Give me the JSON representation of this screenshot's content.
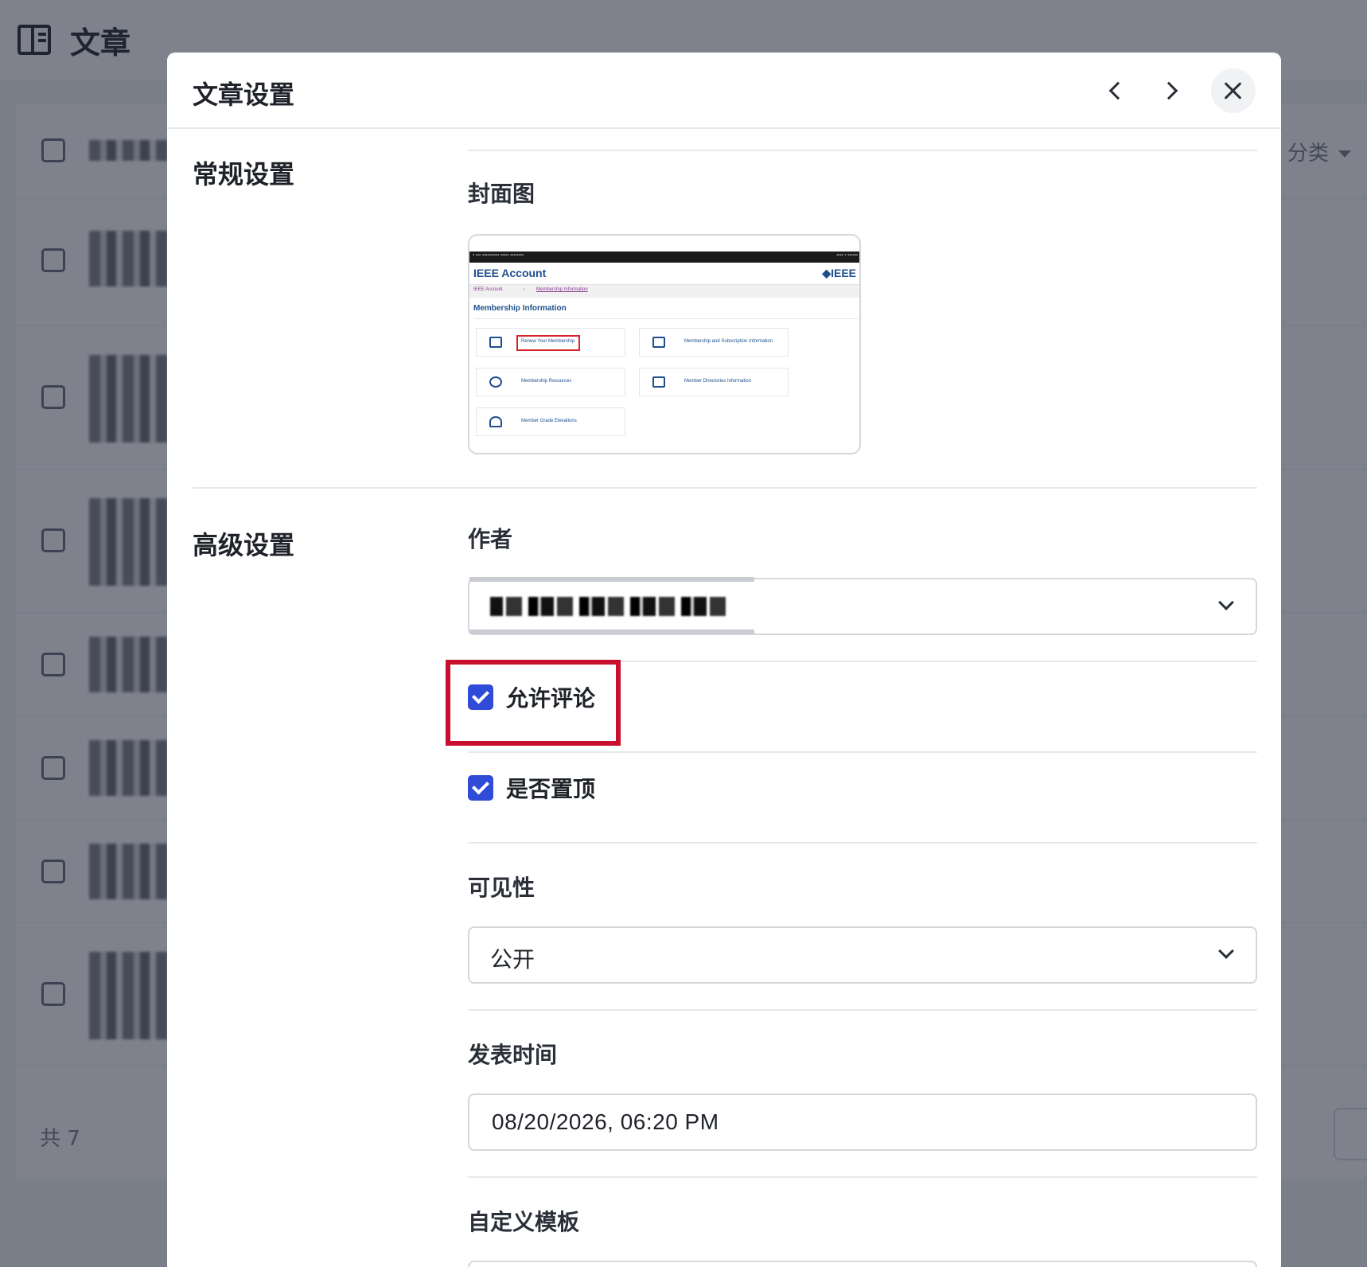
{
  "background": {
    "page_title": "文章",
    "filter_label": "分类",
    "footer_text": "共 7"
  },
  "modal": {
    "title": "文章设置"
  },
  "general": {
    "section_title": "常规设置",
    "cover_label": "封面图",
    "cover_image": {
      "brand": "IEEE Account",
      "logo": "◆IEEE",
      "crumb_home": "IEEE Account",
      "crumb_current": "Membership Information",
      "section": "Membership Information",
      "tiles": [
        "Renew Your Membership",
        "Membership and Subscription Information",
        "Membership Resources",
        "Member Directories Information",
        "Member Grade Elevations"
      ]
    }
  },
  "advanced": {
    "section_title": "高级设置",
    "author_label": "作者",
    "allow_comment_label": "允许评论",
    "allow_comment_checked": true,
    "pin_top_label": "是否置顶",
    "pin_top_checked": true,
    "visibility_label": "可见性",
    "visibility_value": "公开",
    "publish_time_label": "发表时间",
    "publish_time_value": "08/20/2026, 06:20 PM",
    "template_label": "自定义模板"
  },
  "colors": {
    "accent": "#2f4bd8",
    "highlight": "#c8102e"
  }
}
